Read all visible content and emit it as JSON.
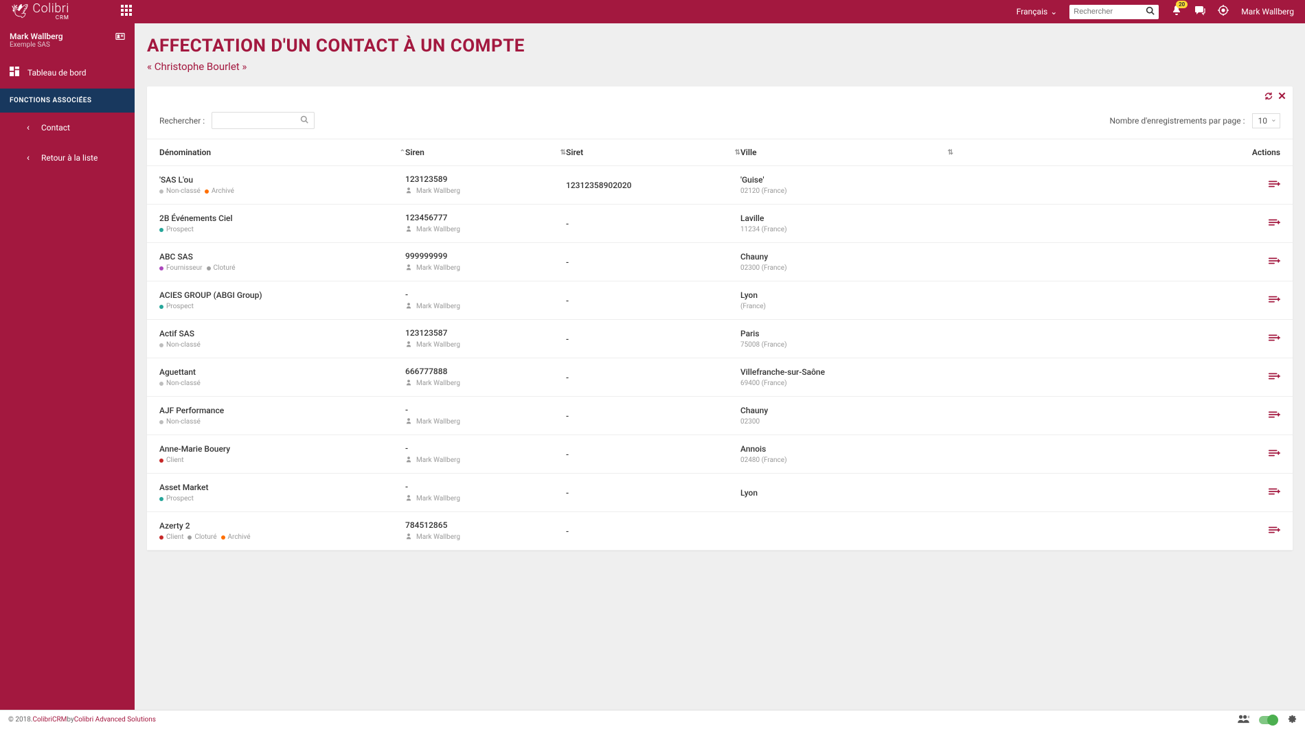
{
  "header": {
    "logo_name": "Colibri",
    "logo_sub": "CRM",
    "language": "Français",
    "search_placeholder": "Rechercher",
    "notifications_count": "20",
    "username": "Mark Wallberg"
  },
  "sidebar": {
    "user_name": "Mark Wallberg",
    "user_company": "Exemple SAS",
    "dashboard_label": "Tableau de bord",
    "functions_label": "FONCTIONS ASSOCIÉES",
    "contact_label": "Contact",
    "return_label": "Retour à la liste"
  },
  "page": {
    "title": "AFFECTATION D'UN CONTACT À UN COMPTE",
    "subtitle": "« Christophe Bourlet »"
  },
  "toolbar": {
    "search_label": "Rechercher :",
    "records_label": "Nombre d'enregistrements par page :",
    "page_size": "10"
  },
  "columns": {
    "denomination": "Dénomination",
    "siren": "Siren",
    "siret": "Siret",
    "ville": "Ville",
    "actions": "Actions"
  },
  "rows": [
    {
      "name": "'SAS L'ou",
      "tags": [
        {
          "label": "Non-classé",
          "color": "grey"
        },
        {
          "label": "Archivé",
          "color": "orange"
        }
      ],
      "siren": "123123589",
      "owner": "Mark Wallberg",
      "siret": "12312358902020",
      "city": "'Guise'",
      "city_sub": "02120 (France)"
    },
    {
      "name": "2B Événements Ciel",
      "tags": [
        {
          "label": "Prospect",
          "color": "green"
        }
      ],
      "siren": "123456777",
      "owner": "Mark Wallberg",
      "siret": "-",
      "city": "Laville",
      "city_sub": "11234 (France)"
    },
    {
      "name": "ABC SAS",
      "tags": [
        {
          "label": "Fournisseur",
          "color": "purple"
        },
        {
          "label": "Cloturé",
          "color": "greyd"
        }
      ],
      "siren": "999999999",
      "owner": "Mark Wallberg",
      "siret": "-",
      "city": "Chauny",
      "city_sub": "02300 (France)"
    },
    {
      "name": "ACIES GROUP (ABGI Group)",
      "tags": [
        {
          "label": "Prospect",
          "color": "green"
        }
      ],
      "siren": "-",
      "owner": "Mark Wallberg",
      "siret": "-",
      "city": "Lyon",
      "city_sub": "(France)"
    },
    {
      "name": "Actif SAS",
      "tags": [
        {
          "label": "Non-classé",
          "color": "grey"
        }
      ],
      "siren": "123123587",
      "owner": "Mark Wallberg",
      "siret": "-",
      "city": "Paris",
      "city_sub": "75008 (France)"
    },
    {
      "name": "Aguettant",
      "tags": [
        {
          "label": "Non-classé",
          "color": "grey"
        }
      ],
      "siren": "666777888",
      "owner": "Mark Wallberg",
      "siret": "-",
      "city": "Villefranche-sur-Saône",
      "city_sub": "69400 (France)"
    },
    {
      "name": "AJF Performance",
      "tags": [
        {
          "label": "Non-classé",
          "color": "grey"
        }
      ],
      "siren": "-",
      "owner": "Mark Wallberg",
      "siret": "-",
      "city": "Chauny",
      "city_sub": "02300"
    },
    {
      "name": "Anne-Marie Bouery",
      "tags": [
        {
          "label": "Client",
          "color": "red"
        }
      ],
      "siren": "-",
      "owner": "Mark Wallberg",
      "siret": "-",
      "city": "Annois",
      "city_sub": "02480 (France)"
    },
    {
      "name": "Asset Market",
      "tags": [
        {
          "label": "Prospect",
          "color": "green"
        }
      ],
      "siren": "-",
      "owner": "Mark Wallberg",
      "siret": "-",
      "city": "Lyon",
      "city_sub": ""
    },
    {
      "name": "Azerty 2",
      "tags": [
        {
          "label": "Client",
          "color": "red"
        },
        {
          "label": "Cloturé",
          "color": "greyd"
        },
        {
          "label": "Archivé",
          "color": "orange"
        }
      ],
      "siren": "784512865",
      "owner": "Mark Wallberg",
      "siret": "-",
      "city": "",
      "city_sub": ""
    }
  ],
  "footer": {
    "copyright": "© 2018. ",
    "brand": "ColibriCRM",
    "by": " by ",
    "company": "Colibri Advanced Solutions"
  }
}
